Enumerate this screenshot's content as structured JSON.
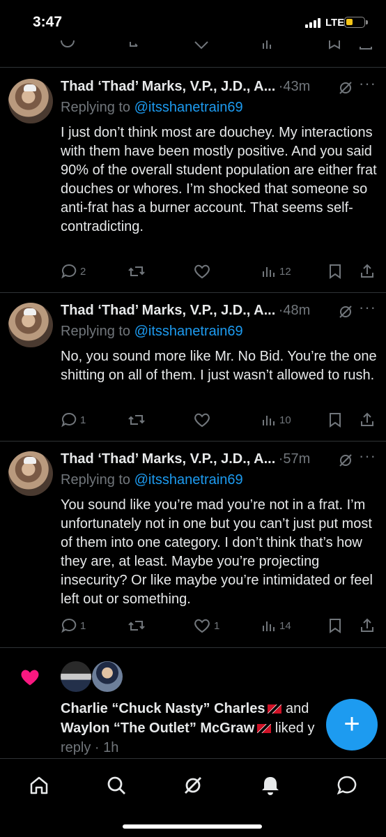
{
  "status_bar": {
    "time": "3:47",
    "network": "LTE"
  },
  "tweets": [
    {
      "author": "Thad ‘Thad’ Marks, V.P., J.D., A...",
      "separator": "·",
      "time_ago": "43m",
      "replying_prefix": "Replying to",
      "replying_handle": "@itsshanetrain69",
      "text": "I just don’t think most are douchey. My interactions with them have been mostly positive. And you said 90% of the overall student population are either frat douches or whores. I’m shocked that someone so anti-frat has a burner account. That seems self-contradicting.",
      "replies": "2",
      "retweets": "",
      "likes": "",
      "views": "12"
    },
    {
      "author": "Thad ‘Thad’ Marks, V.P., J.D., A...",
      "separator": "·",
      "time_ago": "48m",
      "replying_prefix": "Replying to",
      "replying_handle": "@itsshanetrain69",
      "text": "No, you sound more like Mr. No Bid. You’re the one shitting on all of them. I just wasn’t allowed to rush.",
      "replies": "1",
      "retweets": "",
      "likes": "",
      "views": "10"
    },
    {
      "author": "Thad ‘Thad’ Marks, V.P., J.D., A...",
      "separator": "·",
      "time_ago": "57m",
      "replying_prefix": "Replying to",
      "replying_handle": "@itsshanetrain69",
      "text": "You sound like you’re mad you’re not in a frat. I’m unfortunately not in one but you can’t just put most of them into one category. I don’t think that’s how they are, at least. Maybe you’re projecting insecurity? Or like maybe you’re intimidated or feel left out or something.",
      "replies": "1",
      "retweets": "",
      "likes": "1",
      "views": "14"
    }
  ],
  "notification": {
    "user1": "Charlie “Chuck Nasty” Charles",
    "conjunction": "and",
    "user2": "Waylon “The Outlet” McGraw",
    "action": "liked y",
    "continuation": "reply",
    "time": "· 1h"
  },
  "fab_label": "+",
  "colors": {
    "accent": "#1d9bf0",
    "like": "#f91880",
    "muted": "#71767b",
    "text": "#e7e9ea",
    "background": "#000000"
  }
}
